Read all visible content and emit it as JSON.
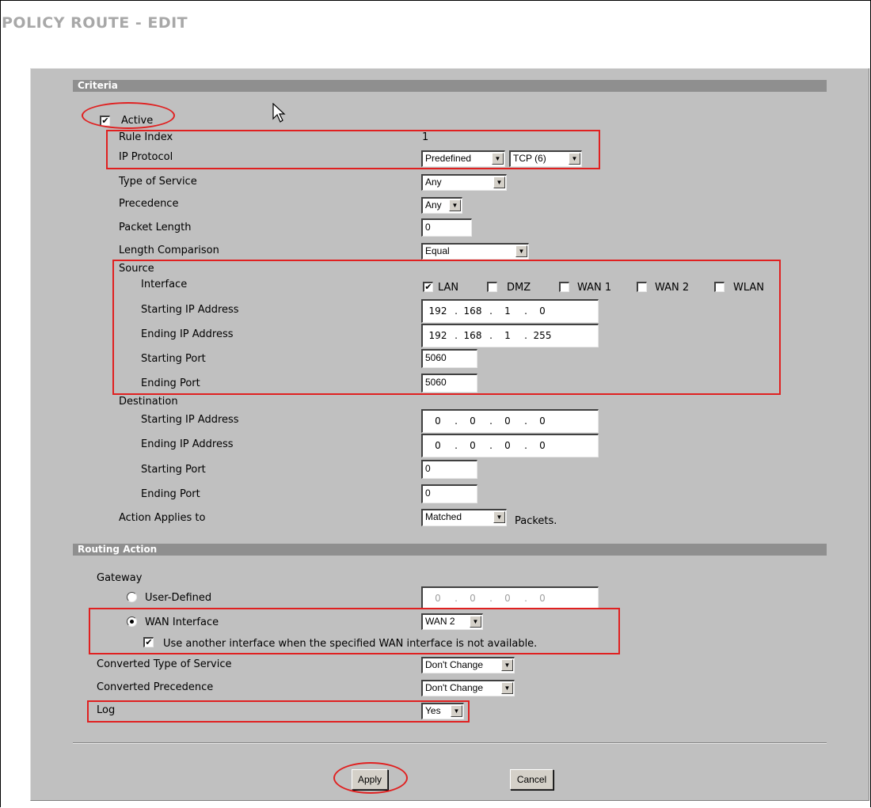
{
  "page": {
    "title": "POLICY ROUTE - EDIT"
  },
  "criteria": {
    "section_title": "Criteria",
    "active_label": "Active",
    "active_checked": true,
    "rule_index_label": "Rule Index",
    "rule_index_value": "1",
    "ip_protocol_label": "IP Protocol",
    "ip_protocol_mode": "Predefined",
    "ip_protocol_value": "TCP (6)",
    "type_of_service_label": "Type of Service",
    "type_of_service_value": "Any",
    "precedence_label": "Precedence",
    "precedence_value": "Any",
    "packet_length_label": "Packet Length",
    "packet_length_value": "0",
    "length_comparison_label": "Length Comparison",
    "length_comparison_value": "Equal",
    "source": {
      "label": "Source",
      "interface_label": "Interface",
      "interfaces": [
        {
          "name": "LAN",
          "checked": true
        },
        {
          "name": "DMZ",
          "checked": false
        },
        {
          "name": "WAN 1",
          "checked": false
        },
        {
          "name": "WAN 2",
          "checked": false
        },
        {
          "name": "WLAN",
          "checked": false
        }
      ],
      "start_ip_label": "Starting IP Address",
      "start_ip": [
        "192",
        "168",
        "1",
        "0"
      ],
      "end_ip_label": "Ending IP Address",
      "end_ip": [
        "192",
        "168",
        "1",
        "255"
      ],
      "start_port_label": "Starting Port",
      "start_port": "5060",
      "end_port_label": "Ending Port",
      "end_port": "5060"
    },
    "destination": {
      "label": "Destination",
      "start_ip_label": "Starting IP Address",
      "start_ip": [
        "0",
        "0",
        "0",
        "0"
      ],
      "end_ip_label": "Ending IP Address",
      "end_ip": [
        "0",
        "0",
        "0",
        "0"
      ],
      "start_port_label": "Starting Port",
      "start_port": "0",
      "end_port_label": "Ending Port",
      "end_port": "0"
    },
    "action_applies_label": "Action Applies to",
    "action_applies_value": "Matched",
    "action_applies_suffix": "Packets."
  },
  "routing": {
    "section_title": "Routing Action",
    "gateway_label": "Gateway",
    "user_defined_label": "User-Defined",
    "user_defined_ip": [
      "0",
      "0",
      "0",
      "0"
    ],
    "wan_interface_label": "WAN Interface",
    "wan_interface_value": "WAN 2",
    "fallback_label": "Use another interface when the specified WAN interface is not available.",
    "fallback_checked": true,
    "converted_tos_label": "Converted Type of Service",
    "converted_tos_value": "Don't Change",
    "converted_precedence_label": "Converted Precedence",
    "converted_precedence_value": "Don't Change",
    "log_label": "Log",
    "log_value": "Yes"
  },
  "buttons": {
    "apply": "Apply",
    "cancel": "Cancel"
  },
  "icons": {
    "select_arrow": "dropdown-arrow-icon",
    "checkmark": "checkmark-icon",
    "cursor": "mouse-pointer-icon"
  },
  "colors": {
    "annotation": "#e02020",
    "panel": "#c0c0c0",
    "section_bar": "#8f8f8f",
    "title": "#a8a8a8"
  }
}
